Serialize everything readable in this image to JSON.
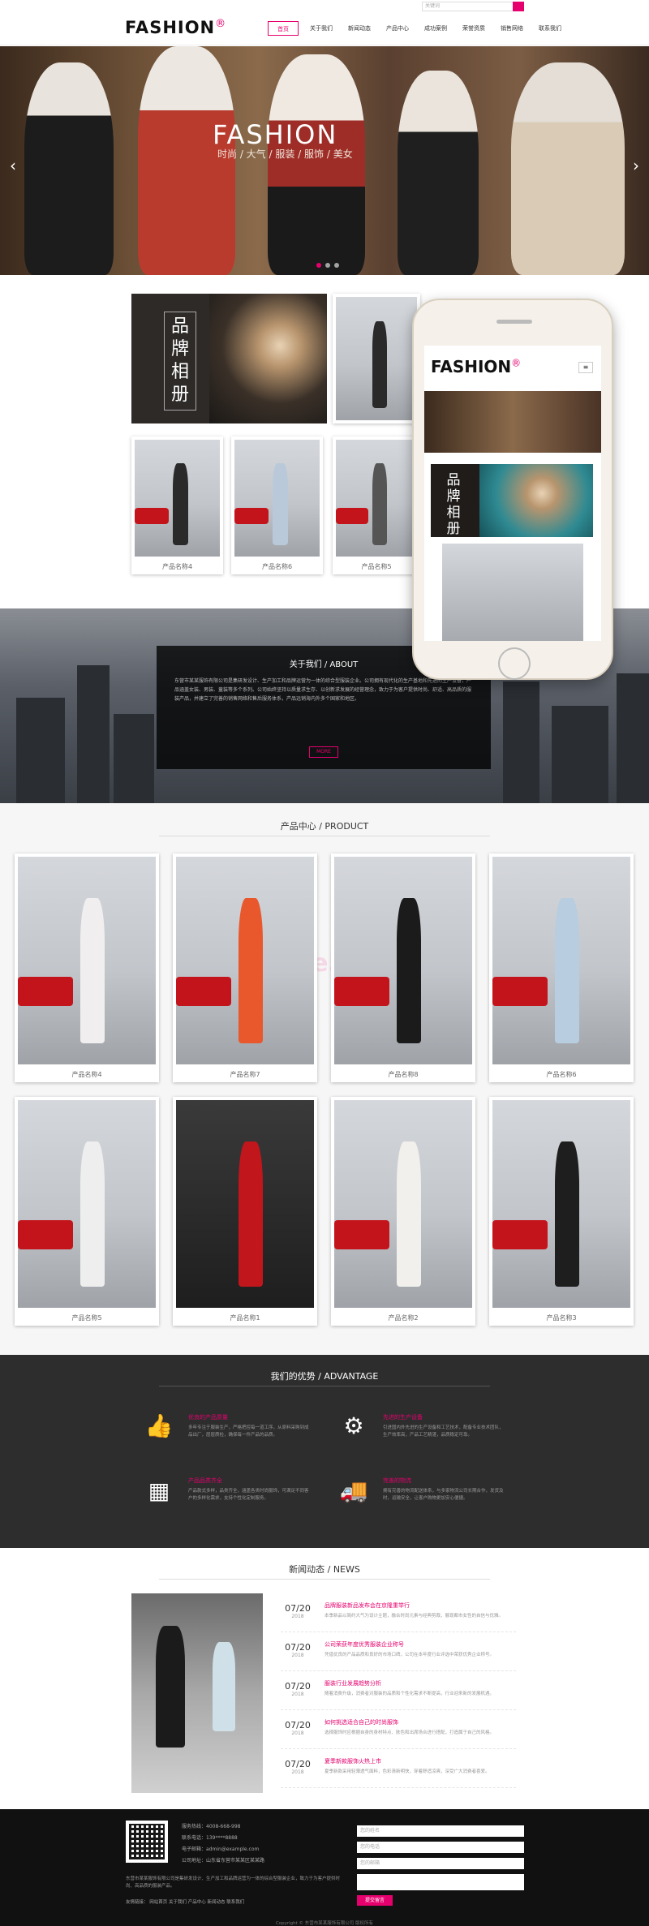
{
  "header": {
    "logo": "FASHION",
    "logo_mark": "®",
    "search_placeholder": "关键词",
    "nav": [
      "首页",
      "关于我们",
      "新闻动态",
      "产品中心",
      "成功案例",
      "荣誉资质",
      "销售网络",
      "联系我们"
    ]
  },
  "banner": {
    "title": "FASHION",
    "subtitle": "时尚 / 大气 / 服装 / 服饰 / 美女"
  },
  "showcase": {
    "brand_text": "品牌相册",
    "products": [
      "产品名称4",
      "产品名称6",
      "产品名称5"
    ]
  },
  "phone": {
    "logo": "FASHION",
    "logo_mark": "®",
    "menu": "≡",
    "brand_text": "品牌相册"
  },
  "about": {
    "title": "关于我们 / ABOUT",
    "text": "东营市某某服饰有限公司是集研发设计、生产加工和品牌运营为一体的综合型服装企业。公司拥有现代化的生产基地和先进的生产设备，产品涵盖女装、男装、童装等多个系列。公司始终坚持以质量求生存、以创新求发展的经营理念，致力于为客户提供时尚、舒适、高品质的服装产品，并建立了完善的销售网络和售后服务体系，产品远销海内外多个国家和地区。",
    "more": "MORE"
  },
  "products": {
    "title": "产品中心 / PRODUCT",
    "items": [
      "产品名称4",
      "产品名称7",
      "产品名称8",
      "产品名称6",
      "产品名称5",
      "产品名称1",
      "产品名称2",
      "产品名称3"
    ]
  },
  "advantage": {
    "title": "我们的优势 / ADVANTAGE",
    "items": [
      {
        "title": "优良的产品质量",
        "text": "多年专注于服装生产，严格把控每一道工序，从原料采购到成品出厂，层层质检，确保每一件产品的品质。"
      },
      {
        "title": "先进的生产设备",
        "text": "引进国内外先进的生产设备和工艺技术，配备专业技术团队，生产效率高，产品工艺精湛，品质稳定可靠。"
      },
      {
        "title": "产品品类齐全",
        "text": "产品款式多样，品类齐全，涵盖各类时尚服饰，可满足不同客户的多样化需求，支持个性化定制服务。"
      },
      {
        "title": "完善的物流",
        "text": "拥有完善的物流配送体系，与多家物流公司长期合作，发货及时，运输安全，让客户购物更加安心便捷。"
      }
    ]
  },
  "news": {
    "title": "新闻动态 / NEWS",
    "items": [
      {
        "md": "07/20",
        "yr": "2018",
        "title": "品牌服装新品发布会在京隆重举行",
        "desc": "本季新品以简约大气为设计主题，融合时尚元素与经典剪裁，展现都市女性的自信与优雅。"
      },
      {
        "md": "07/20",
        "yr": "2018",
        "title": "公司荣获年度优秀服装企业称号",
        "desc": "凭借优良的产品品质和良好的市场口碑，公司在本年度行业评选中荣获优秀企业称号。"
      },
      {
        "md": "07/20",
        "yr": "2018",
        "title": "服装行业发展趋势分析",
        "desc": "随着消费升级，消费者对服装的品质和个性化需求不断提高，行业迎来新的发展机遇。"
      },
      {
        "md": "07/20",
        "yr": "2018",
        "title": "如何挑选适合自己的时尚服饰",
        "desc": "选择服饰时应根据自身的身材特点、肤色和出席场合进行搭配，打造属于自己的风格。"
      },
      {
        "md": "07/20",
        "yr": "2018",
        "title": "夏季新款服饰火热上市",
        "desc": "夏季新款采用轻薄透气面料，色彩清新明快，穿着舒适凉爽，深受广大消费者喜爱。"
      }
    ]
  },
  "footer": {
    "phone_label": "服务热线：4008-668-998",
    "tel_label": "联系电话：139****8888",
    "email_label": "电子邮箱：admin@example.com",
    "addr_label": "公司地址：山东省东营市某某区某某路",
    "about": "东营市某某服饰有限公司是集研发设计、生产加工和品牌运营为一体的综合型服装企业，致力于为客户提供时尚、高品质的服装产品。",
    "links": "友情链接：  网站首页  关于我们  产品中心  新闻动态  联系我们",
    "inputs": [
      "您的姓名",
      "您的电话",
      "您的邮箱"
    ],
    "submit": "提交留言",
    "copyright": "Copyright © 东营市某某服饰有限公司 版权所有"
  },
  "colors": {
    "accent": "#e5006e",
    "dark": "#2d2d2d",
    "footer": "#111111"
  }
}
